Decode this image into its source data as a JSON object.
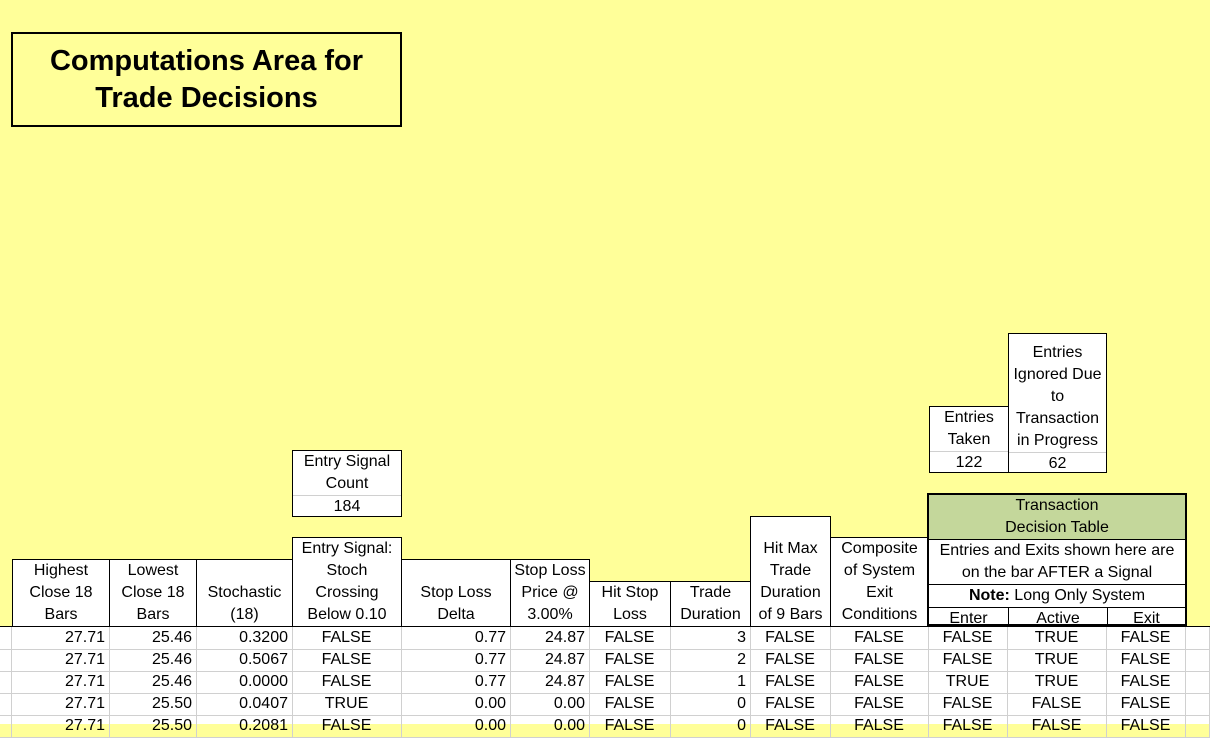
{
  "title": {
    "line1": "Computations Area for",
    "line2": "Trade Decisions"
  },
  "entry_signal_count": {
    "label1": "Entry Signal",
    "label2": "Count",
    "value": "184"
  },
  "entries_taken": {
    "label1": "Entries",
    "label2": "Taken",
    "value": "122"
  },
  "entries_ignored": {
    "label1": "Entries",
    "label2": "Ignored Due",
    "label3": "to",
    "label4": "Transaction",
    "label5": "in Progress",
    "value": "62"
  },
  "decision_table": {
    "title1": "Transaction",
    "title2": "Decision Table",
    "desc1": "Entries and Exits shown here are",
    "desc2": "on the bar AFTER a Signal",
    "note_bold": "Note:",
    "note_text": " Long Only System",
    "col_enter": "Enter",
    "col_active": "Active",
    "col_exit": "Exit"
  },
  "headers": {
    "highest": [
      "Highest",
      "Close 18",
      "Bars"
    ],
    "lowest": [
      "Lowest",
      "Close 18",
      "Bars"
    ],
    "stochastic": [
      "Stochastic",
      "(18)"
    ],
    "entry_signal": [
      "Entry Signal:",
      "Stoch",
      "Crossing",
      "Below 0.10"
    ],
    "stop_delta": [
      "Stop Loss",
      "Delta"
    ],
    "stop_price": [
      "Stop Loss",
      "Price @",
      "3.00%"
    ],
    "hit_stop": [
      "Hit Stop",
      "Loss"
    ],
    "trade_duration": [
      "Trade",
      "Duration"
    ],
    "hit_max": [
      "Hit Max",
      "Trade",
      "Duration",
      "of 9 Bars"
    ],
    "composite": [
      "Composite",
      "of System",
      "Exit",
      "Conditions"
    ]
  },
  "rows": [
    [
      "27.71",
      "25.46",
      "0.3200",
      "FALSE",
      "0.77",
      "24.87",
      "FALSE",
      "3",
      "FALSE",
      "FALSE",
      "FALSE",
      "TRUE",
      "FALSE"
    ],
    [
      "27.71",
      "25.46",
      "0.5067",
      "FALSE",
      "0.77",
      "24.87",
      "FALSE",
      "2",
      "FALSE",
      "FALSE",
      "FALSE",
      "TRUE",
      "FALSE"
    ],
    [
      "27.71",
      "25.46",
      "0.0000",
      "FALSE",
      "0.77",
      "24.87",
      "FALSE",
      "1",
      "FALSE",
      "FALSE",
      "TRUE",
      "TRUE",
      "FALSE"
    ],
    [
      "27.71",
      "25.50",
      "0.0407",
      "TRUE",
      "0.00",
      "0.00",
      "FALSE",
      "0",
      "FALSE",
      "FALSE",
      "FALSE",
      "FALSE",
      "FALSE"
    ],
    [
      "27.71",
      "25.50",
      "0.2081",
      "FALSE",
      "0.00",
      "0.00",
      "FALSE",
      "0",
      "FALSE",
      "FALSE",
      "FALSE",
      "FALSE",
      "FALSE"
    ]
  ]
}
